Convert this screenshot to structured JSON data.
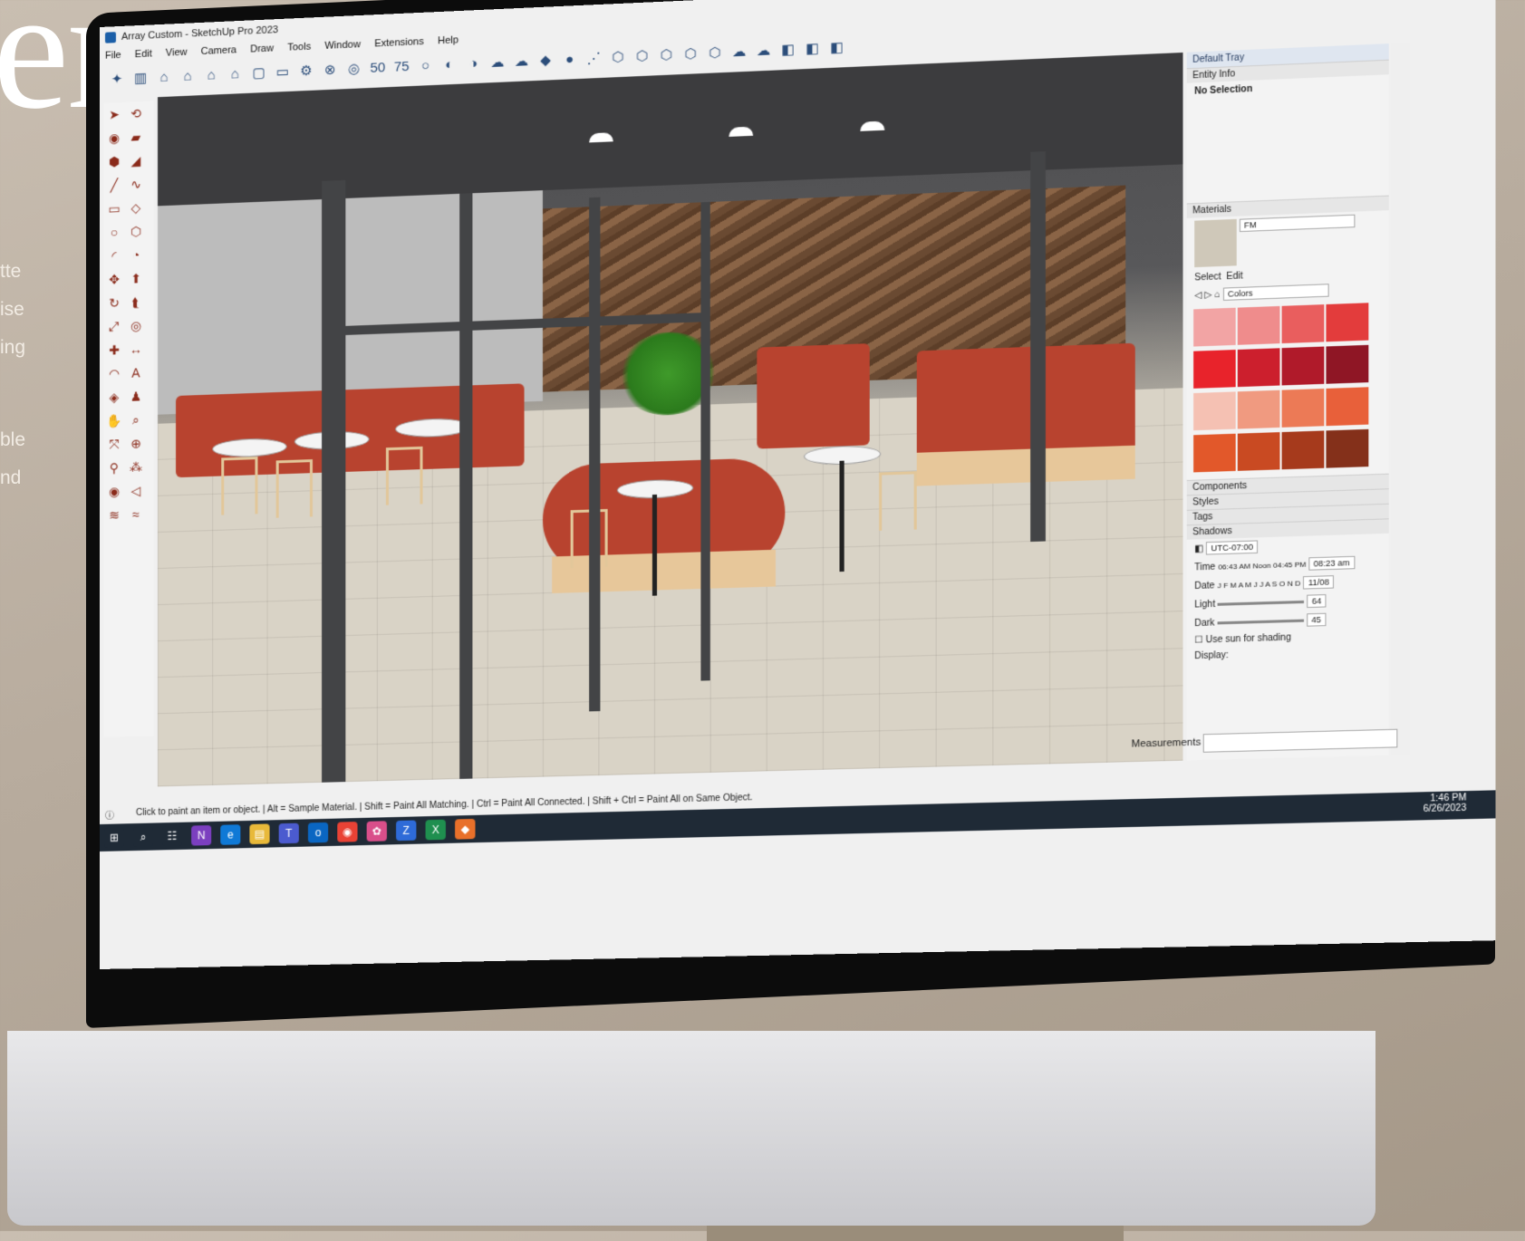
{
  "headline": "ers.",
  "side_fragments": [
    "tte",
    "ise",
    "ing",
    "ble",
    "nd"
  ],
  "window": {
    "title": "Array Custom - SketchUp Pro 2023",
    "minimize": "–",
    "restore": "❐",
    "close": "✕"
  },
  "menu": [
    "File",
    "Edit",
    "View",
    "Camera",
    "Draw",
    "Tools",
    "Window",
    "Extensions",
    "Help"
  ],
  "toolbar_icons": [
    "✦",
    "▥",
    "⌂",
    "⌂",
    "⌂",
    "⌂",
    "▢",
    "▭",
    "⚙",
    "⊗",
    "◎",
    "50",
    "75",
    "○",
    "◐",
    "◑",
    "☁",
    "☁",
    "◆",
    "●",
    "⋰",
    "⬡",
    "⬡",
    "⬡",
    "⬡",
    "⬡",
    "☁",
    "☁",
    "◧",
    "◧",
    "◧"
  ],
  "tray": {
    "title": "Default Tray",
    "entity_info": "Entity Info",
    "no_selection": "No Selection",
    "materials": "Materials",
    "material_name": "FM",
    "tabs": [
      "Select",
      "Edit"
    ],
    "library": "Colors",
    "swatches": [
      "#f2a4a4",
      "#ef8c8c",
      "#e95e5e",
      "#e33c3c",
      "#e8232b",
      "#cc1f2d",
      "#b01a2a",
      "#8f1625",
      "#f5c1b3",
      "#f09a80",
      "#ec7a56",
      "#e8603a",
      "#e2582a",
      "#c94a22",
      "#a63a1c",
      "#84301a"
    ],
    "collapsed": [
      "Components",
      "Styles",
      "Tags"
    ],
    "shadows": "Shadows",
    "timezone": "UTC-07:00",
    "time_label": "Time",
    "time_marks": "06:43 AM  Noon  04:45 PM",
    "time_value": "08:23 am",
    "date_label": "Date",
    "date_marks": "J F M A M J J A S O N D",
    "date_value": "11/08",
    "light_label": "Light",
    "light_value": "64",
    "dark_label": "Dark",
    "dark_value": "45",
    "use_sun": "Use sun for shading",
    "display": "Display:"
  },
  "measurements": "Measurements",
  "status_message": "Click to paint an item or object. | Alt = Sample Material. | Shift = Paint All Matching. | Ctrl = Paint All Connected. | Shift + Ctrl = Paint All on Same Object.",
  "clock": {
    "time": "1:46 PM",
    "date": "6/26/2023"
  },
  "taskbar": [
    "⊞",
    "⌕",
    "☷",
    "N",
    "e",
    "▤",
    "T",
    "o",
    "◉",
    "✿",
    "Z",
    "X",
    "◆"
  ]
}
